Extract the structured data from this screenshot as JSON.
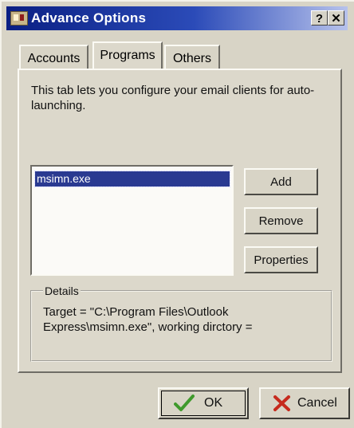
{
  "window": {
    "title": "Advance Options",
    "help_label": "?",
    "close_label": "✕"
  },
  "tabs": [
    {
      "label": "Accounts",
      "active": false
    },
    {
      "label": "Programs",
      "active": true
    },
    {
      "label": "Others",
      "active": false
    }
  ],
  "programs_tab": {
    "description": "This tab lets you configure your email clients for auto-launching.",
    "list_items": [
      "msimn.exe"
    ],
    "selected_item": "msimn.exe",
    "buttons": {
      "add": "Add",
      "remove": "Remove",
      "properties": "Properties"
    },
    "details": {
      "label": "Details",
      "text": "Target = \"C:\\Program Files\\Outlook Express\\msimn.exe\", working dirctory ="
    }
  },
  "dialog_buttons": {
    "ok": "OK",
    "cancel": "Cancel"
  },
  "icons": {
    "app": "mail-app-icon",
    "ok": "checkmark-icon",
    "cancel": "x-icon"
  },
  "colors": {
    "title_bar_start": "#0a1f83",
    "title_bar_end": "#b7c2ec",
    "selection": "#2a3a91",
    "dialog_face": "#d8d4c6"
  }
}
